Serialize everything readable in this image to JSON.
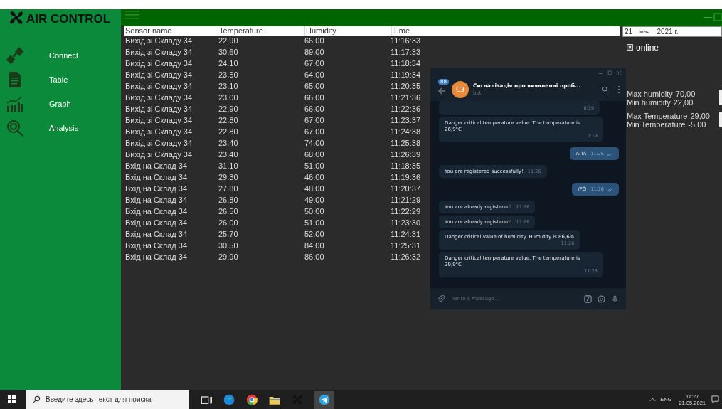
{
  "app": {
    "title": "AIR CONTROL",
    "nav": [
      {
        "label": "Connect"
      },
      {
        "label": "Table"
      },
      {
        "label": "Graph"
      },
      {
        "label": "Analysis"
      }
    ]
  },
  "table": {
    "columns": [
      "Sensor name",
      "Temperature",
      "Humidity",
      "Time"
    ],
    "rows": [
      [
        "Вихід зі Складу 34",
        "22.90",
        "66.00",
        "11:16:33"
      ],
      [
        "Вихід зі Складу 34",
        "30.60",
        "89.00",
        "11:17:33"
      ],
      [
        "Вихід зі Складу 34",
        "24.10",
        "67.00",
        "11:18:34"
      ],
      [
        "Вихід зі Складу 34",
        "23.50",
        "64.00",
        "11:19:34"
      ],
      [
        "Вихід зі Складу 34",
        "23.10",
        "65.00",
        "11:20:35"
      ],
      [
        "Вихід зі Складу 34",
        "23.00",
        "66.00",
        "11:21:36"
      ],
      [
        "Вихід зі Складу 34",
        "22.90",
        "66.00",
        "11:22:36"
      ],
      [
        "Вихід зі Складу 34",
        "22.80",
        "67.00",
        "11:23:37"
      ],
      [
        "Вихід зі Складу 34",
        "22.80",
        "67.00",
        "11:24:38"
      ],
      [
        "Вихід зі Складу 34",
        "23.40",
        "74.00",
        "11:25:38"
      ],
      [
        "Вихід зі Складу 34",
        "23.40",
        "68.00",
        "11:26:39"
      ],
      [
        "Вхід на Склад 34",
        "31.10",
        "51.00",
        "11:18:35"
      ],
      [
        "Вхід на Склад 34",
        "29.30",
        "46.00",
        "11:19:36"
      ],
      [
        "Вхід на Склад 34",
        "27.80",
        "48.00",
        "11:20:37"
      ],
      [
        "Вхід на Склад 34",
        "26.80",
        "49.00",
        "11:21:29"
      ],
      [
        "Вхід на Склад 34",
        "26.50",
        "50.00",
        "11:22:29"
      ],
      [
        "Вхід на Склад 34",
        "26.00",
        "51.00",
        "11:23:30"
      ],
      [
        "Вхід на Склад 34",
        "25.70",
        "52.00",
        "11:24:31"
      ],
      [
        "Вхід на Склад 34",
        "30.50",
        "84.00",
        "11:25:31"
      ],
      [
        "Вхід на Склад 34",
        "29.90",
        "86.00",
        "11:26:32"
      ]
    ]
  },
  "side_panel": {
    "date": {
      "day": "21",
      "month": "мая",
      "year": "2021 г."
    },
    "online": {
      "label": "online",
      "checked": true
    },
    "limits": [
      [
        "Max humidity",
        "70,00"
      ],
      [
        "Min humidity",
        "22,00"
      ],
      [
        "Max Temperature",
        "29,00"
      ],
      [
        "Min Temperature",
        "-5,00"
      ]
    ]
  },
  "chat_window": {
    "badge": "88",
    "avatar": "C3",
    "title": "Сигналізація про виявленні проб...",
    "subtitle": "bot",
    "messages": [
      {
        "kind": "in",
        "time": "0:19"
      },
      {
        "kind": "in",
        "text": "Danger critical temperature value. The temperature is 26,9°C",
        "time": "0:19"
      },
      {
        "kind": "out",
        "text": "АПА",
        "time": "11:26",
        "read": true
      },
      {
        "kind": "in",
        "text": "You are registered successfully!",
        "time": "11:26"
      },
      {
        "kind": "out",
        "text": "/FG",
        "time": "11:26",
        "read": true
      },
      {
        "kind": "in",
        "text": "You are already registered!",
        "time": "11:26"
      },
      {
        "kind": "in",
        "text": "You are already registered!",
        "time": "11:26"
      },
      {
        "kind": "in",
        "text": "Danger critical value of humidity. Humidity is 86,6%",
        "time": "11:26"
      },
      {
        "kind": "in",
        "text": "Danger critical temperature value. The temperature is 29,9°C",
        "time": "11:26"
      }
    ],
    "input": {
      "placeholder": "Write a message..."
    }
  },
  "taskbar": {
    "search": {
      "placeholder": "Введите здесь текст для поиска"
    },
    "language": "ENG",
    "time": "11:27",
    "date": "21.05.2021"
  }
}
